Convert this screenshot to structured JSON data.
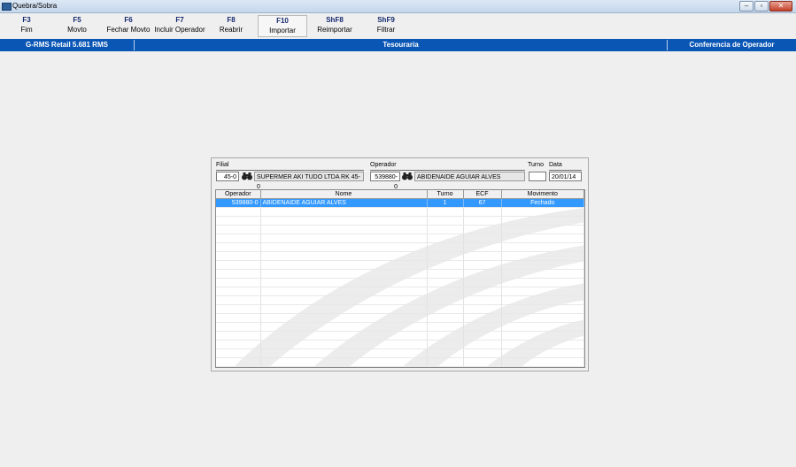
{
  "window": {
    "title": "Quebra/Sobra",
    "buttons": {
      "minimize": "–",
      "maximize": "▫",
      "close": "✕"
    }
  },
  "toolbar": {
    "keys": [
      {
        "key": "F3",
        "label": "Fim"
      },
      {
        "key": "F5",
        "label": "Movto"
      },
      {
        "key": "F6",
        "label": "Fechar Movto"
      },
      {
        "key": "F7",
        "label": "Incluir Operador"
      },
      {
        "key": "F8",
        "label": "Reabrir"
      },
      {
        "key": "F10",
        "label": "Importar"
      },
      {
        "key": "ShF8",
        "label": "Reimportar"
      },
      {
        "key": "ShF9",
        "label": "Filtrar"
      }
    ]
  },
  "statusbar": {
    "version": "G-RMS Retail 5.681 RMS",
    "module": "Tesouraria",
    "screen": "Conferencia de Operador"
  },
  "form": {
    "filial_label": "Filial",
    "filial_code": "45-0",
    "filial_name": "SUPERMER AKI TUDO LTDA RK 45-0",
    "operador_label": "Operador",
    "operador_code": "539880-0",
    "operador_name": "ABIDENAIDE AGUIAR ALVES",
    "turno_label": "Turno",
    "turno_value": "",
    "data_label": "Data",
    "data_value": "20/01/14"
  },
  "grid": {
    "columns": [
      "Operador",
      "Nome",
      "Turno",
      "ECF",
      "Movimento"
    ],
    "rows": [
      {
        "operador": "539880-0",
        "nome": "ABIDENAIDE AGUIAR ALVES",
        "turno": "1",
        "ecf": "67",
        "movimento": "Fechado"
      }
    ],
    "selected_row": 0
  },
  "colors": {
    "statusbar_bg": "#0a56b5",
    "selection_bg": "#3399ff",
    "key_color": "#14286e"
  }
}
